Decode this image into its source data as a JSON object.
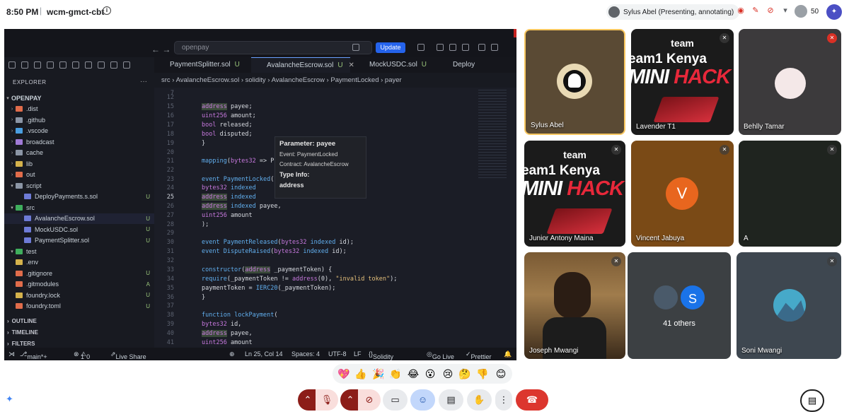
{
  "topbar": {
    "time": "8:50 PM",
    "separator": "|",
    "meeting_code": "wcm-gmct-cbt",
    "presenter": "Sylus Abel (Presenting, annotating)",
    "participant_count": "50"
  },
  "ide": {
    "search": "openpay",
    "update_label": "Update",
    "explorer_title": "EXPLORER",
    "root": "OPENPAY",
    "tree": [
      {
        "name": ".dist",
        "badge": "",
        "kind": "folder",
        "color": "#e06c4b"
      },
      {
        "name": ".github",
        "badge": "",
        "kind": "folder",
        "color": "#8b95a5"
      },
      {
        "name": ".vscode",
        "badge": "",
        "kind": "folder",
        "color": "#4a9ee0"
      },
      {
        "name": "broadcast",
        "badge": "",
        "kind": "folder",
        "color": "#a07ad6"
      },
      {
        "name": "cache",
        "badge": "",
        "kind": "folder",
        "color": "#8b95a5"
      },
      {
        "name": "lib",
        "badge": "",
        "kind": "folder",
        "color": "#d4b24c"
      },
      {
        "name": "out",
        "badge": "",
        "kind": "folder",
        "color": "#e06c4b"
      },
      {
        "name": "script",
        "badge": "",
        "kind": "folder",
        "color": "#8b95a5"
      },
      {
        "name": "DeployPayments.s.sol",
        "badge": "U",
        "kind": "file",
        "color": "#6e7bd6"
      },
      {
        "name": "src",
        "badge": "",
        "kind": "folder",
        "color": "#3fae5d"
      },
      {
        "name": "AvalancheEscrow.sol",
        "badge": "U",
        "kind": "file",
        "color": "#6e7bd6"
      },
      {
        "name": "MockUSDC.sol",
        "badge": "U",
        "kind": "file",
        "color": "#6e7bd6"
      },
      {
        "name": "PaymentSplitter.sol",
        "badge": "U",
        "kind": "file",
        "color": "#6e7bd6"
      },
      {
        "name": "test",
        "badge": "",
        "kind": "folder",
        "color": "#3fae5d"
      },
      {
        "name": ".env",
        "badge": "",
        "kind": "file",
        "color": "#d4b24c"
      },
      {
        "name": ".gitignore",
        "badge": "U",
        "kind": "file",
        "color": "#e06c4b"
      },
      {
        "name": ".gitmodules",
        "badge": "A",
        "kind": "file",
        "color": "#e06c4b"
      },
      {
        "name": "foundry.lock",
        "badge": "U",
        "kind": "file",
        "color": "#d4b24c"
      },
      {
        "name": "foundry.toml",
        "badge": "U",
        "kind": "file",
        "color": "#e06c4b"
      }
    ],
    "sections": [
      "OUTLINE",
      "TIMELINE",
      "FILTERS"
    ],
    "tabs": [
      {
        "label": "PaymentSplitter.sol",
        "flag": "U"
      },
      {
        "label": "AvalancheEscrow.sol",
        "flag": "U"
      },
      {
        "label": "MockUSDC.sol",
        "flag": "U"
      },
      {
        "label": "Deploy",
        "flag": ""
      }
    ],
    "breadcrumb": "src  ›  AvalancheEscrow.sol  ›  solidity  ›  AvalancheEscrow  ›  PaymentLocked  ›  payer",
    "line_numbers": [
      "7",
      "12",
      "15",
      "16",
      "17",
      "18",
      "19",
      "20",
      "21",
      "22",
      "23",
      "24",
      "25",
      "26",
      "27",
      "28",
      "29",
      "30",
      "31",
      "32",
      "33",
      "34",
      "35",
      "36",
      "37",
      "38",
      "39",
      "40",
      "41"
    ],
    "tooltip": {
      "title": "Parameter: payee",
      "event": "Event: PaymentLocked",
      "contract": "Contract: AvalancheEscrow",
      "type_info": "Type Info:",
      "type_value": "address"
    },
    "status": {
      "branch": "main*+",
      "errors": "1",
      "warnings": "0",
      "live_share": "Live Share",
      "position": "Ln 25, Col 14",
      "spaces": "Spaces: 4",
      "encoding": "UTF-8",
      "eol": "LF",
      "language": "Solidity",
      "go_live": "Go Live",
      "prettier": "Prettier"
    }
  },
  "participants": [
    {
      "name": "Sylus Abel",
      "kind": "avatar",
      "bg": "#5a4a34"
    },
    {
      "name": "Lavender T1",
      "kind": "promo"
    },
    {
      "name": "Behlly Tamar",
      "kind": "avatar",
      "bg": "#3c3a3c"
    },
    {
      "name": "Junior Antony Maina",
      "kind": "promo"
    },
    {
      "name": "Vincent Jabuya",
      "kind": "letter",
      "letter": "V",
      "bg": "#7a4a16"
    },
    {
      "name": "A",
      "kind": "blank",
      "bg": "#1f241f"
    },
    {
      "name": "Joseph Mwangi",
      "kind": "video"
    },
    {
      "name": "41 others",
      "kind": "others",
      "letter": "S"
    },
    {
      "name": "Soni Mwangi",
      "kind": "avatar",
      "bg": "#3e4750"
    }
  ],
  "promo": {
    "team": "team",
    "line1": "eam1 Kenya",
    "line2a": "MINI ",
    "line2b": "HACK"
  },
  "emojis": [
    "💖",
    "👍",
    "🎉",
    "👏",
    "😂",
    "😮",
    "😢",
    "🤔",
    "👎",
    "😊"
  ]
}
